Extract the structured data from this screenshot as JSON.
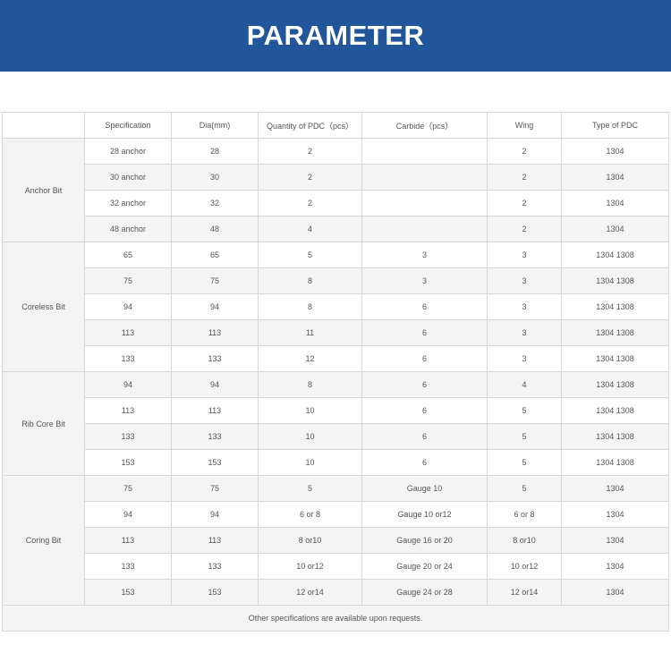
{
  "banner": {
    "title": "PARAMETER"
  },
  "colors": {
    "banner_bg": "#22569b",
    "banner_text": "#ffffff",
    "grid": "#d6d6d6",
    "stripe": "#f4f4f4"
  },
  "table": {
    "headers": [
      "",
      "Specification",
      "Dia(mm)",
      "Quantity of PDC（pcs）",
      "Carbide（pcs）",
      "Wing",
      "Type of PDC"
    ],
    "groups": [
      {
        "category": "Anchor Bit",
        "rows": [
          [
            "28 anchor",
            "28",
            "2",
            "",
            "2",
            "1304"
          ],
          [
            "30 anchor",
            "30",
            "2",
            "",
            "2",
            "1304"
          ],
          [
            "32 anchor",
            "32",
            "2",
            "",
            "2",
            "1304"
          ],
          [
            "48 anchor",
            "48",
            "4",
            "",
            "2",
            "1304"
          ]
        ]
      },
      {
        "category": "Coreless Bit",
        "rows": [
          [
            "65",
            "65",
            "5",
            "3",
            "3",
            "1304   1308"
          ],
          [
            "75",
            "75",
            "8",
            "3",
            "3",
            "1304   1308"
          ],
          [
            "94",
            "94",
            "8",
            "6",
            "3",
            "1304   1308"
          ],
          [
            "113",
            "113",
            "11",
            "6",
            "3",
            "1304   1308"
          ],
          [
            "133",
            "133",
            "12",
            "6",
            "3",
            "1304   1308"
          ]
        ]
      },
      {
        "category": "Rib Core Bit",
        "rows": [
          [
            "94",
            "94",
            "8",
            "6",
            "4",
            "1304   1308"
          ],
          [
            "113",
            "113",
            "10",
            "6",
            "5",
            "1304   1308"
          ],
          [
            "133",
            "133",
            "10",
            "6",
            "5",
            "1304   1308"
          ],
          [
            "153",
            "153",
            "10",
            "6",
            "5",
            "1304   1308"
          ]
        ]
      },
      {
        "category": "Coring Bit",
        "rows": [
          [
            "75",
            "75",
            "5",
            "Gauge 10",
            "5",
            "1304"
          ],
          [
            "94",
            "94",
            "6 or 8",
            "Gauge 10 or12",
            "6 or 8",
            "1304"
          ],
          [
            "113",
            "113",
            "8 or10",
            "Gauge 16 or 20",
            "8 or10",
            "1304"
          ],
          [
            "133",
            "133",
            "10 or12",
            "Gauge 20 or 24",
            "10 or12",
            "1304"
          ],
          [
            "153",
            "153",
            "12 or14",
            "Gauge 24 or 28",
            "12 or14",
            "1304"
          ]
        ]
      }
    ],
    "footer": "Other specifications are available upon requests."
  }
}
